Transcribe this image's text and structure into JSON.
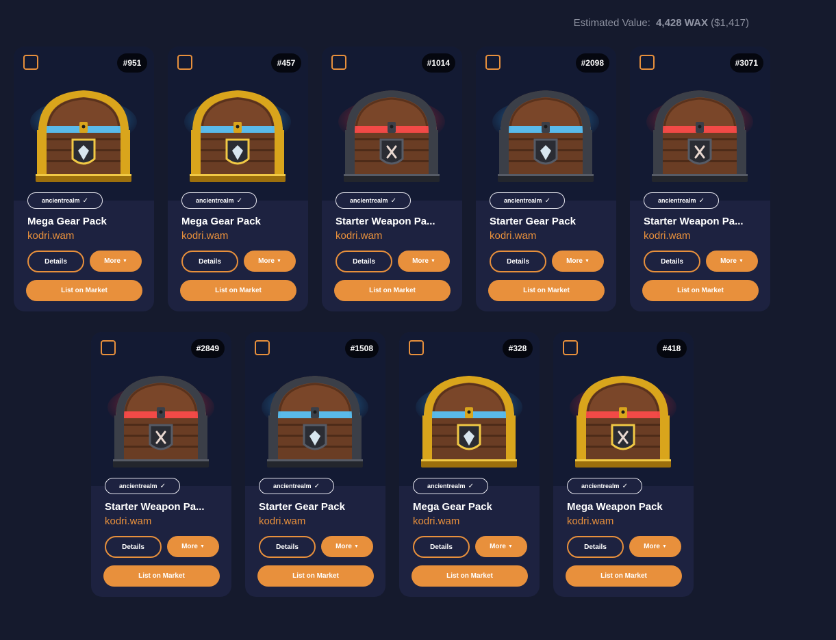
{
  "estimated": {
    "label": "Estimated Value:",
    "wax": "4,428 WAX",
    "usd": "($1,417)"
  },
  "colors": {
    "accent": "#e8903c",
    "card_bg": "#1d2240",
    "page_bg": "#151a2d"
  },
  "labels": {
    "details": "Details",
    "more": "More",
    "list": "List on Market"
  },
  "cards": [
    {
      "mint": "#951",
      "collection": "ancientrealm",
      "name": "Mega Gear Pack",
      "owner": "kodri.wam",
      "chest": "gold",
      "glow": "blue",
      "emblem": "gem"
    },
    {
      "mint": "#457",
      "collection": "ancientrealm",
      "name": "Mega Gear Pack",
      "owner": "kodri.wam",
      "chest": "gold",
      "glow": "blue",
      "emblem": "gem"
    },
    {
      "mint": "#1014",
      "collection": "ancientrealm",
      "name": "Starter Weapon Pa...",
      "owner": "kodri.wam",
      "chest": "dark",
      "glow": "red",
      "emblem": "swords"
    },
    {
      "mint": "#2098",
      "collection": "ancientrealm",
      "name": "Starter Gear Pack",
      "owner": "kodri.wam",
      "chest": "dark",
      "glow": "blue",
      "emblem": "gem"
    },
    {
      "mint": "#3071",
      "collection": "ancientrealm",
      "name": "Starter Weapon Pa...",
      "owner": "kodri.wam",
      "chest": "dark",
      "glow": "red",
      "emblem": "swords"
    },
    {
      "mint": "#2849",
      "collection": "ancientrealm",
      "name": "Starter Weapon Pa...",
      "owner": "kodri.wam",
      "chest": "dark",
      "glow": "red",
      "emblem": "swords"
    },
    {
      "mint": "#1508",
      "collection": "ancientrealm",
      "name": "Starter Gear Pack",
      "owner": "kodri.wam",
      "chest": "dark",
      "glow": "blue",
      "emblem": "gem"
    },
    {
      "mint": "#328",
      "collection": "ancientrealm",
      "name": "Mega Gear Pack",
      "owner": "kodri.wam",
      "chest": "gold",
      "glow": "blue",
      "emblem": "gem"
    },
    {
      "mint": "#418",
      "collection": "ancientrealm",
      "name": "Mega Weapon Pack",
      "owner": "kodri.wam",
      "chest": "gold",
      "glow": "red",
      "emblem": "swords"
    }
  ]
}
